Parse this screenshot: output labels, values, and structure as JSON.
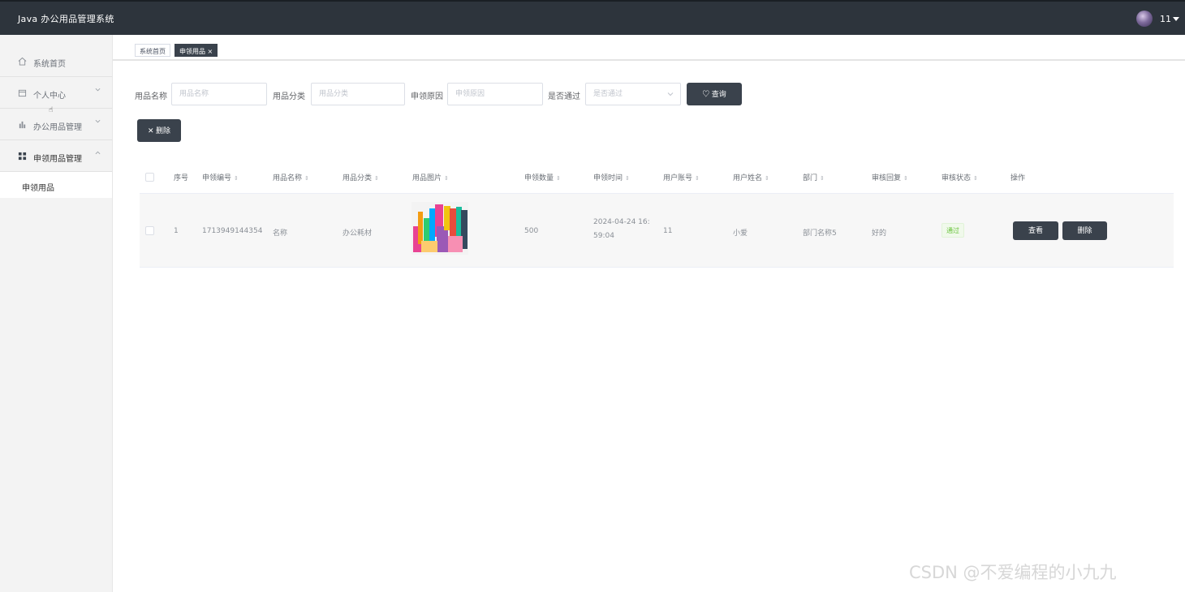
{
  "app": {
    "title": "Java 办公用品管理系统"
  },
  "user": {
    "name": "11"
  },
  "sidebar": {
    "items": [
      {
        "label": "系统首页",
        "icon": "home-icon"
      },
      {
        "label": "个人中心",
        "icon": "calendar-icon"
      },
      {
        "label": "办公用品管理",
        "icon": "bar-chart-icon"
      },
      {
        "label": "申领用品管理",
        "icon": "grid-icon"
      }
    ],
    "sub_items": [
      {
        "label": "申领用品"
      }
    ]
  },
  "tabs": [
    {
      "label": "系统首页"
    },
    {
      "label": "申领用品 ×"
    }
  ],
  "search": {
    "name_label": "用品名称",
    "name_placeholder": "用品名称",
    "category_label": "用品分类",
    "category_placeholder": "用品分类",
    "reason_label": "申领原因",
    "reason_placeholder": "申领原因",
    "passed_label": "是否通过",
    "passed_placeholder": "是否通过",
    "query_button": "♡ 查询"
  },
  "actions": {
    "delete_button": "✕ 删除"
  },
  "table": {
    "headers": [
      "序号",
      "申领编号",
      "用品名称",
      "用品分类",
      "用品图片",
      "申领数量",
      "申领时间",
      "用户账号",
      "用户姓名",
      "部门",
      "审核回复",
      "审核状态",
      "操作"
    ],
    "rows": [
      {
        "index": "1",
        "apply_no": "1713949144354",
        "item_name": "名称",
        "category": "办公耗材",
        "quantity": "500",
        "time_line1": "2024-04-24 16:",
        "time_line2": "59:04",
        "account": "11",
        "username": "小爱",
        "department": "部门名称5",
        "reply": "好的",
        "status": "通过",
        "view_button": "查看",
        "delete_button": "删除"
      }
    ]
  },
  "watermark": "CSDN @不爱编程的小九九",
  "colors": {
    "topbar": "#2d343c",
    "button_dark": "#3a424c",
    "status_green": "#67c23a"
  }
}
